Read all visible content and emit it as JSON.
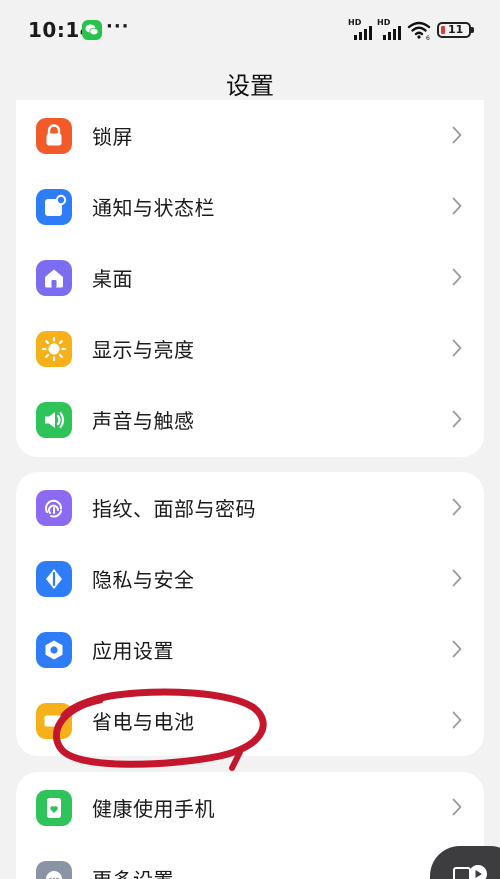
{
  "status_bar": {
    "time": "10:14",
    "more_notifications": "···",
    "signal_1_label": "HD",
    "signal_2_label": "HD",
    "battery_level": "11"
  },
  "header": {
    "title": "设置"
  },
  "groups": [
    {
      "items": [
        {
          "label": "锁屏",
          "icon": "lock-icon",
          "color": "#f25a2a"
        },
        {
          "label": "通知与状态栏",
          "icon": "notification-icon",
          "color": "#2f7df6"
        },
        {
          "label": "桌面",
          "icon": "home-icon",
          "color": "#7b6cf0"
        },
        {
          "label": "显示与亮度",
          "icon": "brightness-icon",
          "color": "#f6b11a"
        },
        {
          "label": "声音与触感",
          "icon": "speaker-icon",
          "color": "#2ec45a"
        }
      ]
    },
    {
      "items": [
        {
          "label": "指纹、面部与密码",
          "icon": "fingerprint-icon",
          "color": "#8c6af2"
        },
        {
          "label": "隐私与安全",
          "icon": "privacy-icon",
          "color": "#2f7df6"
        },
        {
          "label": "应用设置",
          "icon": "app-settings-icon",
          "color": "#2f7df6"
        },
        {
          "label": "省电与电池",
          "icon": "battery-saver-icon",
          "color": "#f6b11a"
        }
      ]
    },
    {
      "items": [
        {
          "label": "健康使用手机",
          "icon": "healthy-use-icon",
          "color": "#2ec45a"
        },
        {
          "label": "更多设置",
          "icon": "more-settings-icon",
          "color": "#8a94a6"
        }
      ]
    }
  ],
  "annotation_color": "#c4172e"
}
